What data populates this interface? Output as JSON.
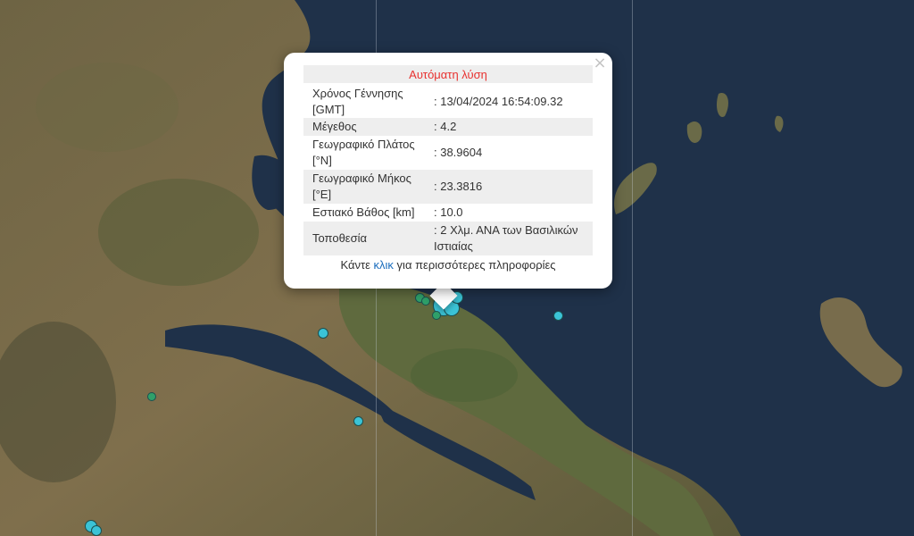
{
  "popup": {
    "title": "Αυτόματη λύση",
    "rows": [
      {
        "label": "Χρόνος Γέννησης [GMT]",
        "value": ": 13/04/2024 16:54:09.32"
      },
      {
        "label": "Μέγεθος",
        "value": ": 4.2"
      },
      {
        "label": "Γεωγραφικό Πλάτος [°N]",
        "value": ": 38.9604"
      },
      {
        "label": "Γεωγραφικό Μήκος [°E]",
        "value": ": 23.3816"
      },
      {
        "label": "Εστιακό Βάθος [km]",
        "value": ": 10.0"
      },
      {
        "label": "Τοποθεσία",
        "value": ": 2 Χλμ. ΑΝΑ των Βασιλικών Ιστιαίας"
      }
    ],
    "more_prefix": "Κάντε ",
    "more_link": "κλικ",
    "more_suffix": " για περισσότερες πληροφορίες",
    "close_symbol": "×"
  },
  "colors": {
    "sea": "#1e2f45",
    "land": "#7a6a48",
    "title_red": "#e8312f",
    "link_blue": "#1a6dbd",
    "quake_cyan": "#3bc3d6",
    "quake_green": "#2fa06a"
  }
}
